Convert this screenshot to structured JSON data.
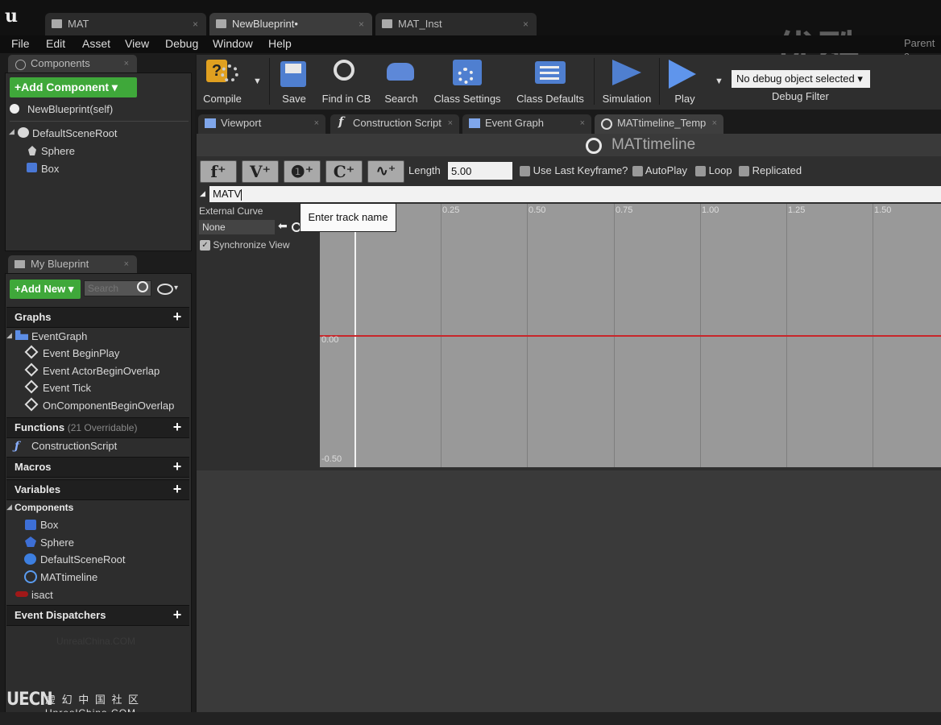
{
  "document_tabs": [
    {
      "label": "MAT",
      "close": "×"
    },
    {
      "label": "NewBlueprint•",
      "close": "×"
    },
    {
      "label": "MAT_Inst",
      "close": "×"
    }
  ],
  "watermark": "优酷",
  "parent_label": "Parent c",
  "menu": [
    "File",
    "Edit",
    "Asset",
    "View",
    "Debug",
    "Window",
    "Help"
  ],
  "components_panel": {
    "tab_label": "Components",
    "add_button": "+Add Component ▾",
    "self_item": "NewBlueprint(self)",
    "tree": [
      "DefaultSceneRoot",
      "Sphere",
      "Box"
    ]
  },
  "my_blueprint_panel": {
    "tab_label": "My Blueprint",
    "add_new": "+Add New ▾",
    "search_placeholder": "Search",
    "graphs_header": "Graphs",
    "event_graph": "EventGraph",
    "events": [
      "Event BeginPlay",
      "Event ActorBeginOverlap",
      "Event Tick",
      "OnComponentBeginOverlap"
    ],
    "functions_header": "Functions",
    "functions_note": "(21 Overridable)",
    "construction_script": "ConstructionScript",
    "macros_header": "Macros",
    "variables_header": "Variables",
    "components_subheader": "Components",
    "variable_components": [
      "Box",
      "Sphere",
      "DefaultSceneRoot",
      "MATtimeline"
    ],
    "isact": "isact",
    "dispatchers_header": "Event Dispatchers",
    "faint_watermark": "UnrealChina.COM"
  },
  "brand": {
    "logo": "UECN",
    "chinese": "虚 幻 中 国 社 区",
    "site": "UnrealChina.COM"
  },
  "toolbar": {
    "buttons": [
      "Compile",
      "Save",
      "Find in CB",
      "Search",
      "Class Settings",
      "Class Defaults",
      "Simulation",
      "Play"
    ],
    "debug_select": "No debug object selected ▾",
    "debug_filter": "Debug Filter"
  },
  "graph_tabs": [
    "Viewport",
    "Construction Script",
    "Event Graph",
    "MATtimeline_Temp"
  ],
  "timeline": {
    "title": "MATtimeline",
    "buttons": [
      "f⁺",
      "V⁺",
      "❶⁺",
      "C⁺",
      "∿⁺"
    ],
    "length_label": "Length",
    "length_value": "5.00",
    "options": [
      "Use Last Keyframe?",
      "AutoPlay",
      "Loop",
      "Replicated"
    ],
    "track_name_value": "MATV",
    "tooltip": "Enter track name",
    "external_curve_label": "External Curve",
    "external_curve_value": "None",
    "synchronize_view": "Synchronize View",
    "x_ticks": [
      "0.25",
      "0.50",
      "0.75",
      "1.00",
      "1.25",
      "1.50"
    ],
    "y_ticks": [
      "0.00",
      "-0.50"
    ],
    "curve_color": "#c8262a"
  }
}
